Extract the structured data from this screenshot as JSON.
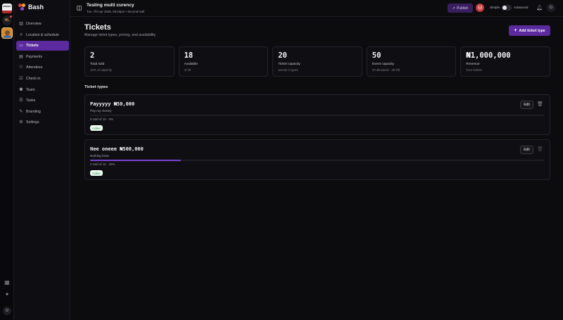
{
  "rail": {
    "workspaces": [
      {
        "icon": "workspace-logo-icon",
        "text": "ARSENAL"
      },
      {
        "icon": "workspace-hl-icon",
        "text": "HL"
      },
      {
        "icon": "workspace-avatar-icon",
        "text": ""
      }
    ],
    "bottom_icons": [
      "grid-icon",
      "sparkle-icon"
    ],
    "user_initial": "O"
  },
  "brand": {
    "name": "Bash",
    "colors": [
      "#e0413a",
      "#f2a62b",
      "#8b4ad8"
    ]
  },
  "sidebar": {
    "items": [
      {
        "label": "Overview",
        "icon": "chart-icon",
        "active": false
      },
      {
        "label": "Location & schedule",
        "icon": "location-icon",
        "active": false
      },
      {
        "label": "Tickets",
        "icon": "ticket-icon",
        "active": true
      },
      {
        "label": "Payments",
        "icon": "payments-icon",
        "active": false
      },
      {
        "label": "Attendees",
        "icon": "attendees-icon",
        "active": false
      },
      {
        "label": "Check-in",
        "icon": "check-in-icon",
        "active": false
      },
      {
        "label": "Team",
        "icon": "team-icon",
        "active": false
      },
      {
        "label": "Tasks",
        "icon": "tasks-icon",
        "active": false
      },
      {
        "label": "Branding",
        "icon": "branding-icon",
        "active": false
      },
      {
        "label": "Settings",
        "icon": "settings-icon",
        "active": false
      }
    ]
  },
  "header": {
    "event_title": "Testing multi curency",
    "event_subtitle": "Tue, 7th Apr 2026, 09:10pm • Second Hall",
    "publish_label": "Publish",
    "avatar_initial": "🐱",
    "mode_simple": "Simple",
    "mode_advanced": "Advanced",
    "user_initial": "O"
  },
  "page": {
    "title": "Tickets",
    "subtitle": "Manage ticket types, pricing, and availability",
    "add_button": "Add ticket type",
    "section_title": "Ticket types"
  },
  "stats": [
    {
      "value": "2",
      "label": "Total sold",
      "sub": "10% of capacity"
    },
    {
      "value": "18",
      "label": "Available",
      "sub": "of 20"
    },
    {
      "value": "20",
      "label": "Ticket capacity",
      "sub": "across 2 types"
    },
    {
      "value": "50",
      "label": "Event capacity",
      "sub": "20 allocated · 30 left"
    },
    {
      "value": "₦1,000,000",
      "label": "Revenue",
      "sub": "from tickets"
    }
  ],
  "tickets": [
    {
      "title": "Payyyyy  ₦50,000",
      "description": "Pay my money",
      "sold_text": "0 sold of 10 · 0%",
      "progress": 0,
      "status": "Active",
      "edit_label": "Edit"
    },
    {
      "title": "Nee oneee  ₦500,000",
      "description": "Nothing boss",
      "sold_text": "2 sold of 10 · 20%",
      "progress": 0.2,
      "status": "Active",
      "edit_label": "Edit"
    }
  ],
  "colors": {
    "accent": "#5b2a9e",
    "progress": "#7a43d6",
    "status_active_bg": "#f0fbf2",
    "status_active_text": "#1f8a4c"
  }
}
